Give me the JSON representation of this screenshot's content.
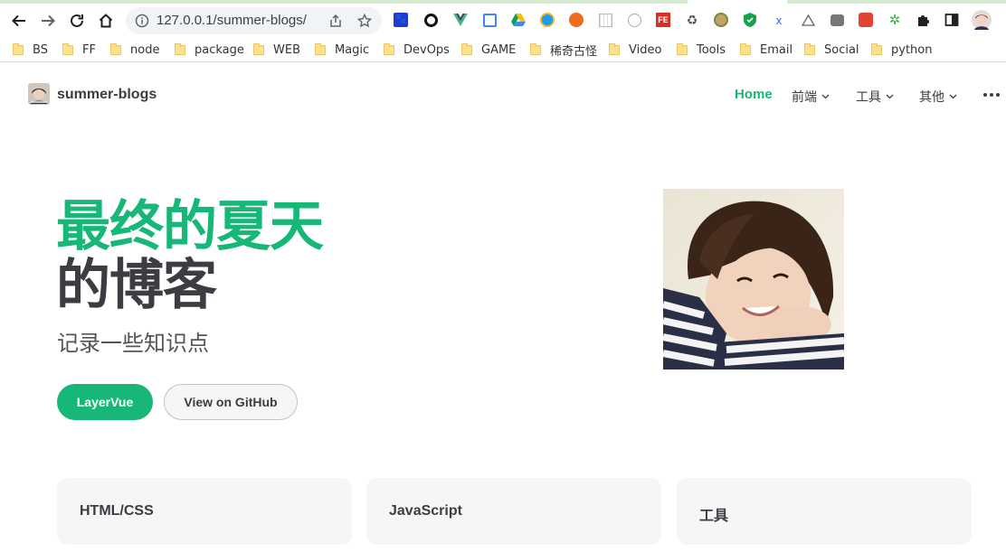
{
  "browser": {
    "url": "127.0.0.1/summer-blogs/",
    "extensions": [
      "paw-icon",
      "circle-icon",
      "vue-icon",
      "translate-icon",
      "drive-icon",
      "compass-icon",
      "fire-icon",
      "grid-icon",
      "clock-icon",
      "fe-icon",
      "recycle-icon",
      "face-icon",
      "shield-icon",
      "x-icon",
      "triangle-icon",
      "tab-icon",
      "todoist-icon",
      "star-icon",
      "puzzle-icon",
      "sidepanel-icon",
      "profile-avatar"
    ],
    "bookmarks": [
      "BS",
      "FF",
      "node",
      "package",
      "WEB",
      "Magic",
      "DevOps",
      "GAME",
      "稀奇古怪",
      "Video",
      "Tools",
      "Email",
      "Social",
      "python"
    ]
  },
  "site": {
    "title": "summer-blogs",
    "nav": {
      "home": "Home",
      "frontend": "前端",
      "tools": "工具",
      "other": "其他"
    },
    "colors": {
      "brand": "#16b777",
      "text": "#3c3c43"
    }
  },
  "hero": {
    "name": "最终的夏天",
    "text": "的博客",
    "tagline": "记录一些知识点",
    "actions": {
      "primary": "LayerVue",
      "secondary": "View on GitHub"
    }
  },
  "features": [
    "HTML/CSS",
    "JavaScript",
    "工具"
  ]
}
